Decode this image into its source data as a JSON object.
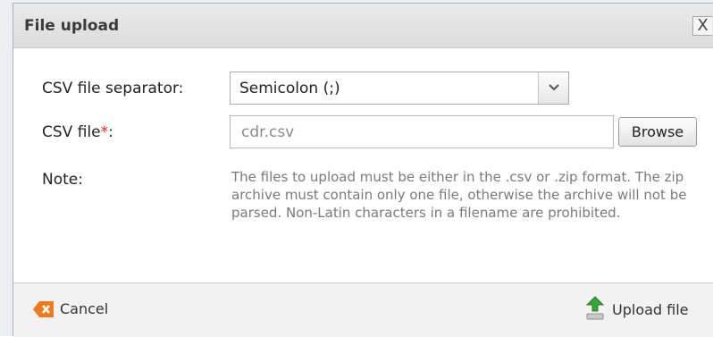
{
  "dialog": {
    "title": "File upload",
    "close_label": "X"
  },
  "form": {
    "separator_label": "CSV file separator:",
    "separator_value": "Semicolon (;)",
    "file_label": "CSV file",
    "file_required_mark": "*",
    "file_label_suffix": ":",
    "file_value": "cdr.csv",
    "browse_label": "Browse",
    "note_label": "Note:",
    "note_text": "The files to upload must be either in the .csv or .zip format. The zip archive must contain only one file, otherwise the archive will not be parsed. Non-Latin characters in a filename are prohibited."
  },
  "footer": {
    "cancel_label": "Cancel",
    "upload_label": "Upload file"
  },
  "icons": {
    "close": "close-icon",
    "dropdown": "chevron-down-icon",
    "cancel": "cancel-x-icon",
    "upload": "upload-arrow-icon"
  },
  "colors": {
    "required": "#e02020",
    "cancel_icon": "#f07a1a",
    "upload_icon": "#3aa53a"
  }
}
